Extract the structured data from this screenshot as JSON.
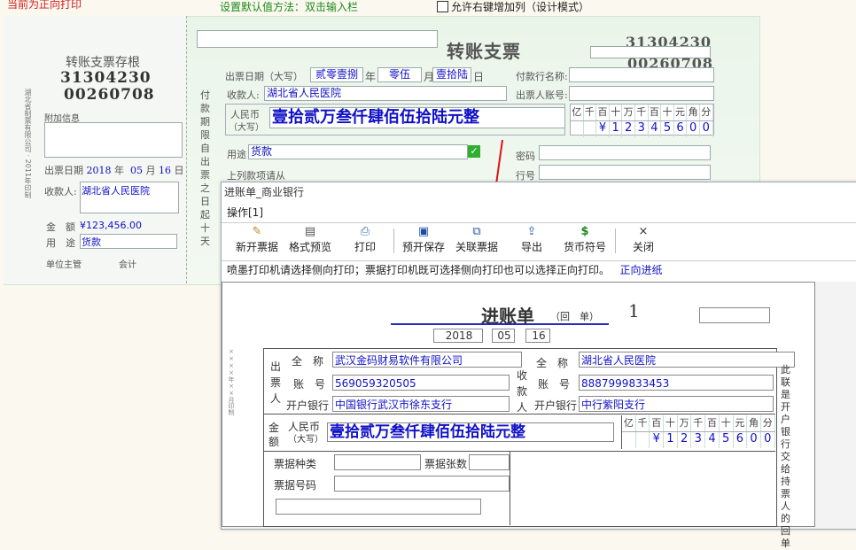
{
  "top": {
    "print_label": "当前为正向打印",
    "default_hint": "设置默认值方法：双击输入栏",
    "allow_add_col": "允许右键增加列（设计模式）"
  },
  "stub": {
    "title": "转账支票存根",
    "code": "31304230",
    "number": "00260708",
    "side_text": "湖北省制票有限公司 · 2011年印制",
    "note_label": "附加信息",
    "date_label": "出票日期",
    "date_year": "2018",
    "date_year_unit": "年",
    "date_month": "05",
    "date_month_unit": "月",
    "date_day": "16",
    "date_day_unit": "日",
    "payee_label": "收款人:",
    "payee_value": "湖北省人民医院",
    "amount_label": "金　额",
    "amount_value": "¥123,456.00",
    "usage_label": "用　途",
    "usage_value": "货款",
    "manager_label": "单位主管",
    "accountant_label": "会计"
  },
  "cheque": {
    "title": "转账支票",
    "code": "31304230",
    "number": "00260708",
    "date_label": "出票日期（大写）",
    "year_value": "贰零壹捌",
    "year_unit": "年",
    "month_value": "零伍",
    "month_unit": "月",
    "day_value": "壹拾陆",
    "day_unit": "日",
    "payee_label": "收款人:",
    "payee_value": "湖北省人民医院",
    "bank_label": "付款行名称:",
    "account_label": "出票人账号:",
    "rmb_label": "人民币",
    "rmb_sub": "（大写）",
    "amount_upper": "壹拾贰万叁仟肆佰伍拾陆元整",
    "digit_headers": [
      "亿",
      "千",
      "百",
      "十",
      "万",
      "千",
      "百",
      "十",
      "元",
      "角",
      "分"
    ],
    "digits": [
      "",
      "",
      "¥",
      "1",
      "2",
      "3",
      "4",
      "5",
      "6",
      "0",
      "0"
    ],
    "vertical_text": "付款期限自出票之日起十天",
    "usage_label": "用途",
    "usage_value": "货款",
    "password_label": "密码",
    "line_label": "行号",
    "above_label": "上列款项请从"
  },
  "dialog": {
    "title": "进账单_商业银行",
    "menu": "操作[1]",
    "toolbar": [
      {
        "label": "新开票据",
        "icon": "new-document-icon"
      },
      {
        "label": "格式预览",
        "icon": "preview-icon"
      },
      {
        "label": "打印",
        "icon": "printer-icon"
      },
      {
        "label": "预开保存",
        "icon": "save-icon"
      },
      {
        "label": "关联票据",
        "icon": "link-documents-icon"
      },
      {
        "label": "导出",
        "icon": "export-icon"
      },
      {
        "label": "货币符号",
        "icon": "currency-icon"
      },
      {
        "label": "关闭",
        "icon": "close-icon"
      }
    ],
    "icon_glyphs": {
      "new": "✎",
      "preview": "▤",
      "print": "⎙",
      "save": "▣",
      "link": "⧉",
      "export": "⇪",
      "currency": "$",
      "close": "×"
    },
    "note": "喷墨打印机请选择侧向打印；票据打印机既可选择侧向打印也可以选择正向打印。",
    "forward_link": "正向进纸"
  },
  "deposit": {
    "title": "进账单",
    "subtitle": "（回　单）",
    "number": "1",
    "year": "2018",
    "month": "05",
    "day": "16",
    "payer_label": "出票人",
    "payee_label": "收款人",
    "name_label": "全　称",
    "account_label": "账　号",
    "bank_label": "开户银行",
    "payer_name": "武汉金码财易软件有限公司",
    "payer_account": "569059320505",
    "payer_bank": "中国银行武汉市徐东支行",
    "payee_name": "湖北省人民医院",
    "payee_account": "8887999833453",
    "payee_bank": "中行紫阳支行",
    "amount_label": "金额",
    "rmb_label": "人民币",
    "rmb_sub": "（大写）",
    "amount_upper": "壹拾贰万叁仟肆佰伍拾陆元整",
    "digit_headers": [
      "亿",
      "千",
      "百",
      "十",
      "万",
      "千",
      "百",
      "十",
      "元",
      "角",
      "分"
    ],
    "digits": [
      "",
      "",
      "¥",
      "1",
      "2",
      "3",
      "4",
      "5",
      "6",
      "0",
      "0"
    ],
    "bill_type_label": "票据种类",
    "bill_count_label": "票据张数",
    "bill_number_label": "票据号码",
    "side_note": "此联是开户银行交给持票人的回单"
  }
}
